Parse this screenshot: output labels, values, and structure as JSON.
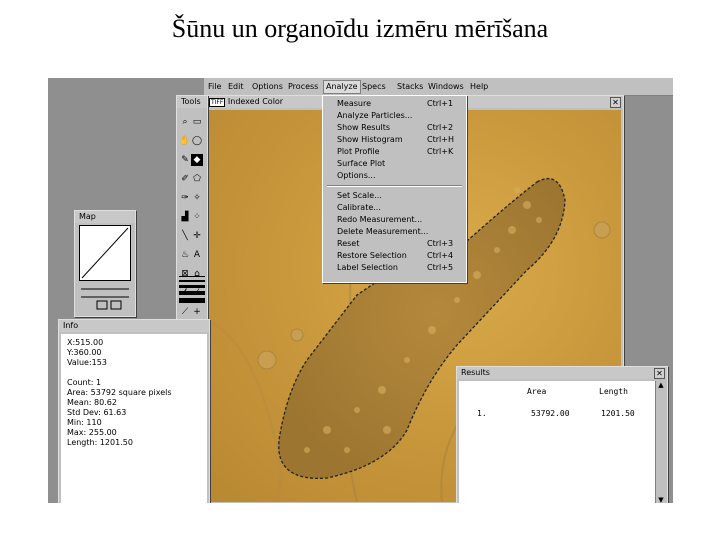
{
  "slide_title": "Šūnu un organoīdu izmēru mērīšana",
  "menubar": [
    "File",
    "Edit",
    "Options",
    "Process",
    "Analyze",
    "Specs",
    "Stacks",
    "Windows",
    "Help"
  ],
  "image_window": {
    "title": "Indexed Color",
    "badge": "TIFF"
  },
  "tools_window": {
    "title": "Tools"
  },
  "map_window": {
    "title": "Map"
  },
  "analyze_menu": [
    {
      "label": "Measure",
      "shortcut": "Ctrl+1"
    },
    {
      "label": "Analyze Particles...",
      "shortcut": ""
    },
    {
      "label": "Show Results",
      "shortcut": "Ctrl+2"
    },
    {
      "label": "Show Histogram",
      "shortcut": "Ctrl+H"
    },
    {
      "label": "Plot Profile",
      "shortcut": "Ctrl+K"
    },
    {
      "label": "Surface Plot",
      "shortcut": ""
    },
    {
      "label": "Options...",
      "shortcut": ""
    },
    {
      "label": "Set Scale...",
      "shortcut": ""
    },
    {
      "label": "Calibrate...",
      "shortcut": ""
    },
    {
      "label": "Redo Measurement...",
      "shortcut": ""
    },
    {
      "label": "Delete Measurement...",
      "shortcut": ""
    },
    {
      "label": "Reset",
      "shortcut": "Ctrl+3"
    },
    {
      "label": "Restore Selection",
      "shortcut": "Ctrl+4"
    },
    {
      "label": "Label Selection",
      "shortcut": "Ctrl+5"
    }
  ],
  "info": {
    "title": "Info",
    "lines": [
      "X:515.00",
      "Y:360.00",
      "Value:153",
      "",
      "Count: 1",
      "Area: 53792 square pixels",
      "Mean: 80.62",
      "Std Dev: 61.63",
      "Min: 110",
      "Max: 255.00",
      "Length: 1201.50"
    ]
  },
  "results": {
    "title": "Results",
    "headers": [
      "Area",
      "Length"
    ],
    "rows": [
      {
        "index": "1.",
        "area": "53792.00",
        "length": "1201.50"
      }
    ]
  },
  "colors": {
    "screen_gray": "#8f8f8f",
    "chrome": "#c0c0c0",
    "micrograph": "#c7953a"
  }
}
